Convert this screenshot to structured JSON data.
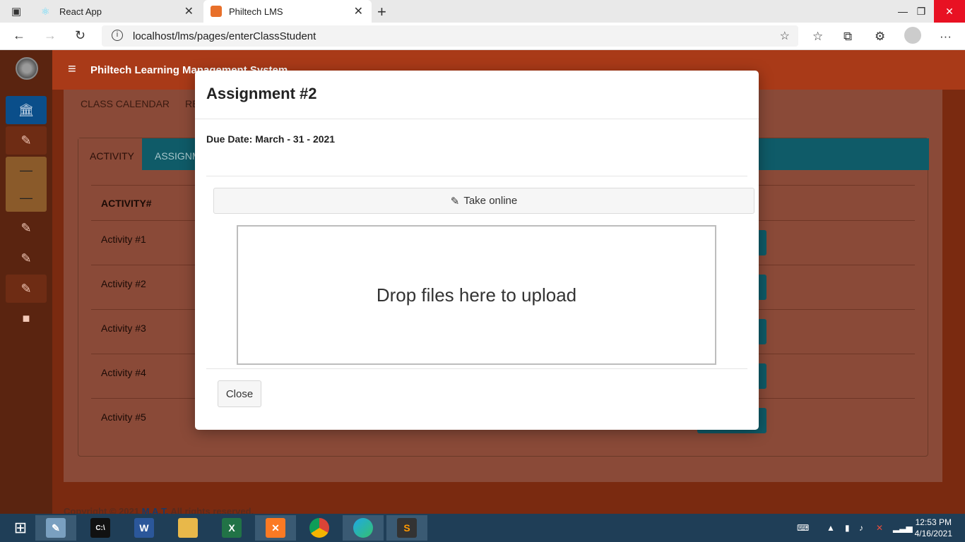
{
  "browser": {
    "tabs": [
      {
        "title": "React App"
      },
      {
        "title": "Philtech LMS"
      }
    ],
    "url": "localhost/lms/pages/enterClassStudent"
  },
  "app": {
    "title": "Philtech Learning Management System",
    "subnav": "CLASS CALENDAR",
    "subnav_partial": "RE",
    "tabs": [
      "ACTIVITY",
      "ASSIGNM"
    ],
    "table_header": "ACTIVITY#",
    "rows": [
      "Activity #1",
      "Activity #2",
      "Activity #3",
      "Activity #4",
      "Activity #5"
    ],
    "footer_prefix": "Copyright © 2021 ",
    "footer_link": "M.A.T.",
    "footer_suffix": " All rights reserved."
  },
  "modal": {
    "title": "Assignment #2",
    "due_label": "Due Date:",
    "due_value": "March - 31 - 2021",
    "take_online": "Take online",
    "dropzone": "Drop files here to upload",
    "close": "Close"
  },
  "taskbar": {
    "time": "12:53 PM",
    "date": "4/16/2021"
  }
}
